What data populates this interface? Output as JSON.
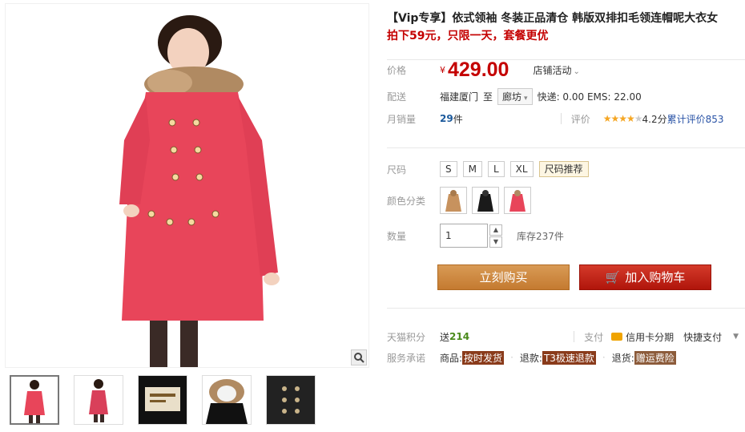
{
  "product": {
    "title": "【Vip专享】依式领袖 冬装正品清仓 韩版双排扣毛领连帽呢大衣女",
    "subtitle": "拍下59元，只限一天，套餐更优"
  },
  "price": {
    "label": "价格",
    "currency": "¥",
    "value": "429.00",
    "promo": "店铺活动"
  },
  "shipping": {
    "label": "配送",
    "from": "福建厦门",
    "to_word": "至",
    "city": "廊坊",
    "fees": "快递: 0.00 EMS: 22.00"
  },
  "sales": {
    "label": "月销量",
    "count": "29",
    "unit": "件",
    "rating_label": "评价",
    "rating_value": 4.2,
    "rating_text": "4.2分",
    "reviews_text": "累计评价853"
  },
  "size": {
    "label": "尺码",
    "options": [
      "S",
      "M",
      "L",
      "XL"
    ],
    "recommend": "尺码推荐"
  },
  "color": {
    "label": "颜色分类",
    "options": [
      "camel",
      "black",
      "red"
    ]
  },
  "quantity": {
    "label": "数量",
    "value": "1",
    "stock": "库存237件"
  },
  "buttons": {
    "buy": "立刻购买",
    "cart": "加入购物车"
  },
  "points": {
    "label": "天猫积分",
    "prefix": "送",
    "value": "214",
    "pay_label": "支付",
    "card": "信用卡分期",
    "quick": "快捷支付"
  },
  "service": {
    "label": "服务承诺",
    "goods": "商品:",
    "goods_tag": "按时发货",
    "refund": "退款:",
    "refund_tag": "T3极速退款",
    "return": "退货:",
    "return_tag": "赠运费险"
  },
  "colors": {
    "price_red": "#c40000",
    "buy_orange": "#c47a30",
    "cart_red": "#b0150b"
  }
}
